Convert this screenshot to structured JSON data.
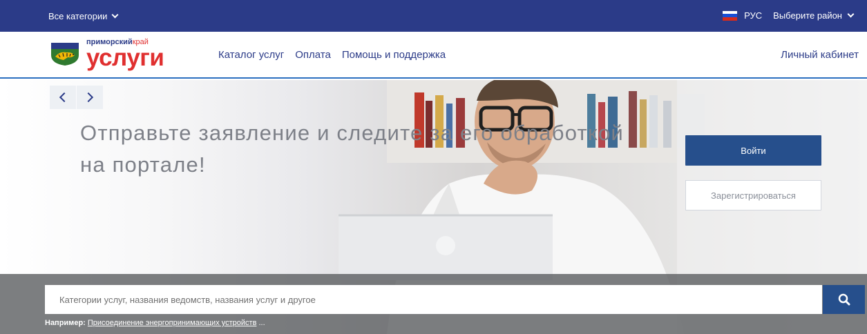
{
  "topbar": {
    "categories_label": "Все категории",
    "language": "РУС",
    "district_label": "Выберите район"
  },
  "header": {
    "logo_small_part1": "приморский",
    "logo_small_part2": "край",
    "logo_big": "услуги",
    "nav": [
      "Каталог услуг",
      "Оплата",
      "Помощь и поддержка"
    ],
    "cabinet": "Личный кабинет"
  },
  "hero": {
    "headline_line1": "Отправьте заявление и следите за его обработкой",
    "headline_line2": "на портале!",
    "login_button": "Войти",
    "register_button": "Зарегистрироваться"
  },
  "search": {
    "placeholder": "Категории услуг, названия ведомств, названия услуг и другое",
    "example_label": "Например:",
    "example_link": "Присоединение энергопринимающих устройств",
    "example_suffix": " ..."
  },
  "colors": {
    "topbar": "#2b3b88",
    "brand_red": "#e03030",
    "button_blue": "#264f8c"
  },
  "icons": [
    "chevron-down-icon",
    "russian-flag-icon",
    "krai-emblem-icon",
    "chevron-left-icon",
    "chevron-right-icon",
    "search-icon"
  ]
}
